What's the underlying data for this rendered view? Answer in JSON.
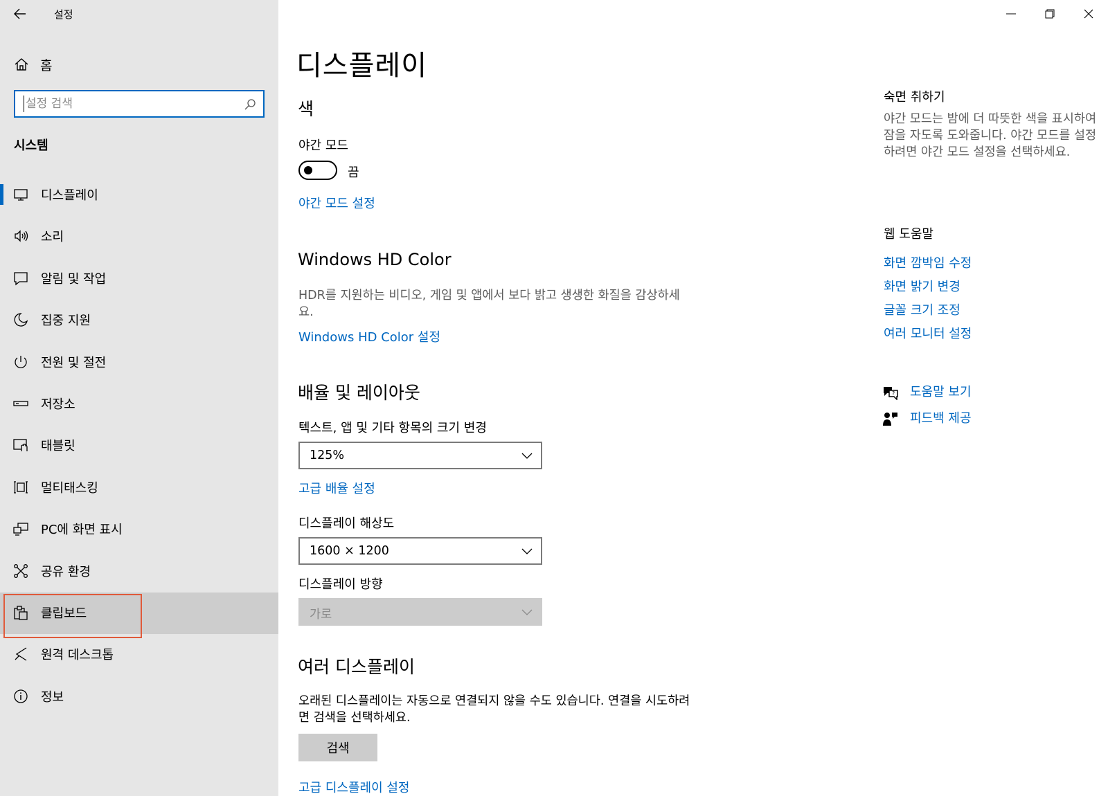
{
  "window": {
    "app_title": "설정",
    "back_label": "←",
    "minimize": "—",
    "maximize": "❐",
    "close": "✕"
  },
  "sidebar": {
    "home_label": "홈",
    "search_placeholder": "설정 검색",
    "section_title": "시스템",
    "items": [
      {
        "label": "디스플레이",
        "icon": "monitor-icon"
      },
      {
        "label": "소리",
        "icon": "speaker-icon"
      },
      {
        "label": "알림 및 작업",
        "icon": "notification-icon"
      },
      {
        "label": "집중 지원",
        "icon": "moon-icon"
      },
      {
        "label": "전원 및 절전",
        "icon": "power-icon"
      },
      {
        "label": "저장소",
        "icon": "storage-icon"
      },
      {
        "label": "태블릿",
        "icon": "tablet-icon"
      },
      {
        "label": "멀티태스킹",
        "icon": "multitasking-icon"
      },
      {
        "label": "PC에 화면 표시",
        "icon": "project-icon"
      },
      {
        "label": "공유 환경",
        "icon": "share-icon"
      },
      {
        "label": "클립보드",
        "icon": "clipboard-icon"
      },
      {
        "label": "원격 데스크톱",
        "icon": "remote-desktop-icon"
      },
      {
        "label": "정보",
        "icon": "info-icon"
      }
    ],
    "selected_index": 0,
    "highlighted_index": 10
  },
  "main": {
    "page_title": "디스플레이",
    "color_section": {
      "title": "색",
      "night_mode_label": "야간 모드",
      "toggle_state": "끔",
      "night_mode_settings_link": "야간 모드 설정"
    },
    "hdr_section": {
      "title": "Windows HD Color",
      "description": "HDR를 지원하는 비디오, 게임 및 앱에서 보다 밝고 생생한 화질을 감상하세요.",
      "link": "Windows HD Color 설정"
    },
    "scale_section": {
      "title": "배율 및 레이아웃",
      "scale_label": "텍스트, 앱 및 기타 항목의 크기 변경",
      "scale_value": "125%",
      "advanced_scale_link": "고급 배율 설정",
      "resolution_label": "디스플레이 해상도",
      "resolution_value": "1600 × 1200",
      "orientation_label": "디스플레이 방향",
      "orientation_value": "가로"
    },
    "multi_display_section": {
      "title": "여러 디스플레이",
      "description": "오래된 디스플레이는 자동으로 연결되지 않을 수도 있습니다. 연결을 시도하려면 검색을 선택하세요.",
      "detect_button": "검색",
      "advanced_link": "고급 디스플레이 설정"
    }
  },
  "right_column": {
    "sleep_title": "숙면 취하기",
    "sleep_description": "야간 모드는 밤에 더 따뜻한 색을 표시하여 잠을 자도록 도와줍니다. 야간 모드를 설정하려면 야간 모드 설정을 선택하세요.",
    "web_help_title": "웹 도움말",
    "web_help_links": [
      "화면 깜박임 수정",
      "화면 밝기 변경",
      "글꼴 크기 조정",
      "여러 모니터 설정"
    ],
    "get_help": "도움말 보기",
    "give_feedback": "피드백 제공"
  },
  "colors": {
    "accent": "#0067c0",
    "sidebar_bg": "#e6e6e6",
    "highlight_border": "#e05a3a"
  }
}
